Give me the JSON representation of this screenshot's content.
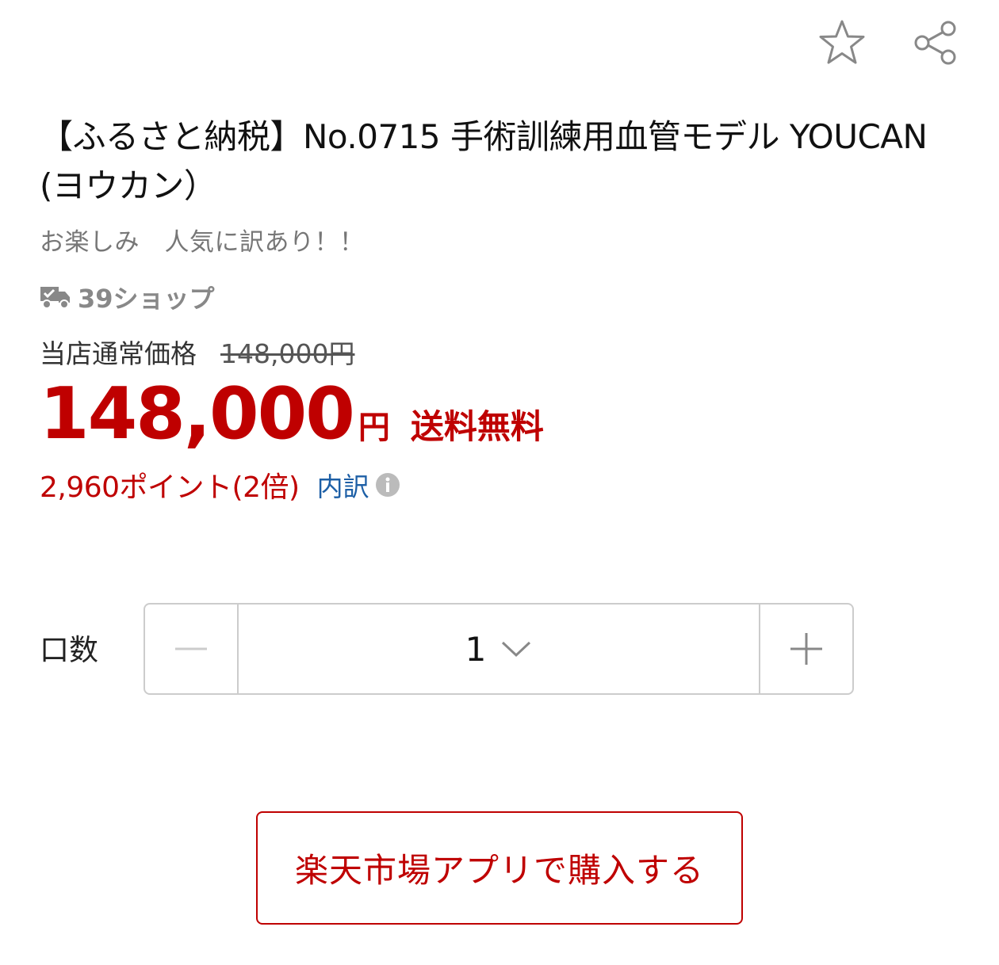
{
  "header": {
    "favorite_icon": "star-outline-icon",
    "share_icon": "share-icon"
  },
  "product": {
    "title": "【ふるさと納税】No.0715 手術訓練用血管モデル YOUCAN (ヨウカン）",
    "catch_copy": "お楽しみ　人気に訳あり！！",
    "shipping_badge_label": "39ショップ",
    "regular_price_label": "当店通常価格",
    "regular_price": "148,000円",
    "price": "148,000",
    "price_unit": "円",
    "free_shipping": "送料無料",
    "points": "2,960ポイント(2倍)",
    "breakdown_label": "内訳"
  },
  "quantity": {
    "label": "口数",
    "value": "1"
  },
  "actions": {
    "buy_in_app_label": "楽天市場アプリで購入する"
  },
  "colors": {
    "accent": "#bf0000",
    "link": "#1d5fa6",
    "muted": "#777777"
  }
}
